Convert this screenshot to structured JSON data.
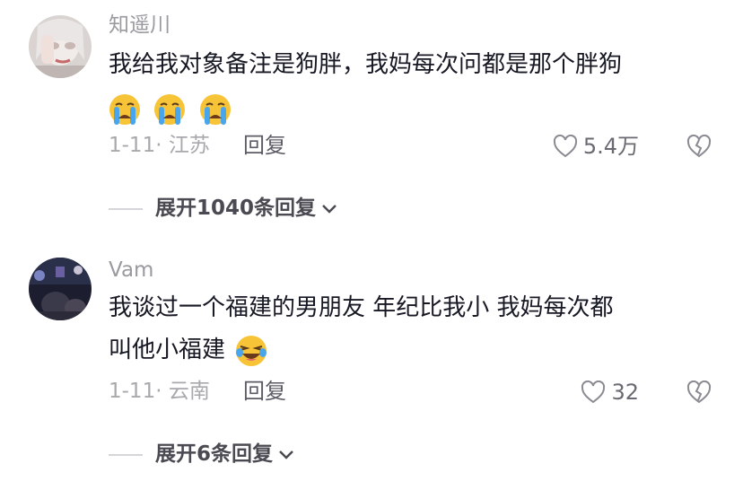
{
  "comments": [
    {
      "username": "知遥川",
      "text": "我给我对象备注是狗胖，我妈每次问都是那个胖狗",
      "emoji_icon": "loudly-crying-face-icon",
      "date_location": "1-11· 江苏",
      "reply_label": "回复",
      "likes": "5.4万",
      "expand_label": "展开1040条回复"
    },
    {
      "username": "Vam",
      "text_line1": "我谈过一个福建的男朋友 年纪比我小 我妈每次都",
      "text_line2": "叫他小福建",
      "emoji_icon": "laughing-tears-face-icon",
      "date_location": "1-11· 云南",
      "reply_label": "回复",
      "likes": "32",
      "expand_label": "展开6条回复"
    }
  ],
  "colors": {
    "primary_text": "#161823",
    "secondary_text": "#9a9aa0",
    "emoji_yellow": "#f7c438",
    "tear_blue": "#4aa6ec"
  }
}
